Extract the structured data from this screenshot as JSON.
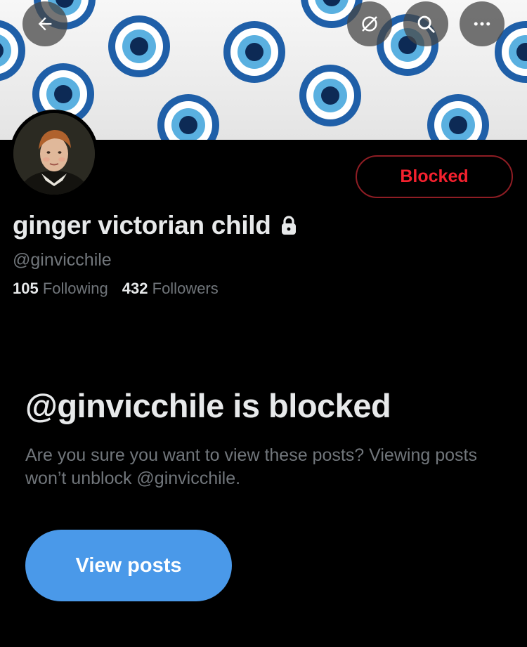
{
  "header": {
    "back_icon": "arrow-left-icon",
    "sync_icon": "circle-slash-icon",
    "search_icon": "search-icon",
    "more_icon": "more-horizontal-icon"
  },
  "profile": {
    "display_name": "ginger victorian child",
    "lock_icon": "lock-icon",
    "handle": "@ginvicchile",
    "following_count": "105",
    "following_label": "Following",
    "followers_count": "432",
    "followers_label": "Followers",
    "blocked_button_label": "Blocked"
  },
  "blocked_notice": {
    "title": "@ginvicchile is blocked",
    "description": "Are you sure you want to view these posts? Viewing posts won’t unblock @ginvicchile.",
    "view_button_label": "View posts"
  },
  "colors": {
    "background": "#000000",
    "blocked_red": "#f4212e",
    "accent_blue": "#4a99e9",
    "muted_text": "#71767b"
  }
}
